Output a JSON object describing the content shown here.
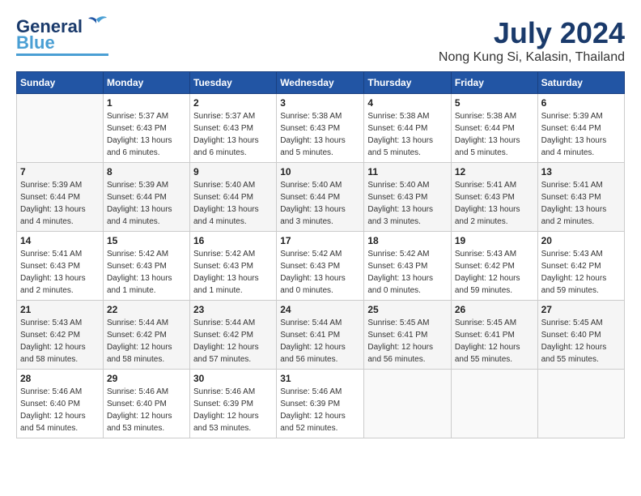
{
  "header": {
    "logo_general": "General",
    "logo_blue": "Blue",
    "month_year": "July 2024",
    "location": "Nong Kung Si, Kalasin, Thailand"
  },
  "weekdays": [
    "Sunday",
    "Monday",
    "Tuesday",
    "Wednesday",
    "Thursday",
    "Friday",
    "Saturday"
  ],
  "weeks": [
    [
      {
        "day": "",
        "info": ""
      },
      {
        "day": "1",
        "info": "Sunrise: 5:37 AM\nSunset: 6:43 PM\nDaylight: 13 hours\nand 6 minutes."
      },
      {
        "day": "2",
        "info": "Sunrise: 5:37 AM\nSunset: 6:43 PM\nDaylight: 13 hours\nand 6 minutes."
      },
      {
        "day": "3",
        "info": "Sunrise: 5:38 AM\nSunset: 6:43 PM\nDaylight: 13 hours\nand 5 minutes."
      },
      {
        "day": "4",
        "info": "Sunrise: 5:38 AM\nSunset: 6:44 PM\nDaylight: 13 hours\nand 5 minutes."
      },
      {
        "day": "5",
        "info": "Sunrise: 5:38 AM\nSunset: 6:44 PM\nDaylight: 13 hours\nand 5 minutes."
      },
      {
        "day": "6",
        "info": "Sunrise: 5:39 AM\nSunset: 6:44 PM\nDaylight: 13 hours\nand 4 minutes."
      }
    ],
    [
      {
        "day": "7",
        "info": "Sunrise: 5:39 AM\nSunset: 6:44 PM\nDaylight: 13 hours\nand 4 minutes."
      },
      {
        "day": "8",
        "info": "Sunrise: 5:39 AM\nSunset: 6:44 PM\nDaylight: 13 hours\nand 4 minutes."
      },
      {
        "day": "9",
        "info": "Sunrise: 5:40 AM\nSunset: 6:44 PM\nDaylight: 13 hours\nand 4 minutes."
      },
      {
        "day": "10",
        "info": "Sunrise: 5:40 AM\nSunset: 6:44 PM\nDaylight: 13 hours\nand 3 minutes."
      },
      {
        "day": "11",
        "info": "Sunrise: 5:40 AM\nSunset: 6:43 PM\nDaylight: 13 hours\nand 3 minutes."
      },
      {
        "day": "12",
        "info": "Sunrise: 5:41 AM\nSunset: 6:43 PM\nDaylight: 13 hours\nand 2 minutes."
      },
      {
        "day": "13",
        "info": "Sunrise: 5:41 AM\nSunset: 6:43 PM\nDaylight: 13 hours\nand 2 minutes."
      }
    ],
    [
      {
        "day": "14",
        "info": "Sunrise: 5:41 AM\nSunset: 6:43 PM\nDaylight: 13 hours\nand 2 minutes."
      },
      {
        "day": "15",
        "info": "Sunrise: 5:42 AM\nSunset: 6:43 PM\nDaylight: 13 hours\nand 1 minute."
      },
      {
        "day": "16",
        "info": "Sunrise: 5:42 AM\nSunset: 6:43 PM\nDaylight: 13 hours\nand 1 minute."
      },
      {
        "day": "17",
        "info": "Sunrise: 5:42 AM\nSunset: 6:43 PM\nDaylight: 13 hours\nand 0 minutes."
      },
      {
        "day": "18",
        "info": "Sunrise: 5:42 AM\nSunset: 6:43 PM\nDaylight: 13 hours\nand 0 minutes."
      },
      {
        "day": "19",
        "info": "Sunrise: 5:43 AM\nSunset: 6:42 PM\nDaylight: 12 hours\nand 59 minutes."
      },
      {
        "day": "20",
        "info": "Sunrise: 5:43 AM\nSunset: 6:42 PM\nDaylight: 12 hours\nand 59 minutes."
      }
    ],
    [
      {
        "day": "21",
        "info": "Sunrise: 5:43 AM\nSunset: 6:42 PM\nDaylight: 12 hours\nand 58 minutes."
      },
      {
        "day": "22",
        "info": "Sunrise: 5:44 AM\nSunset: 6:42 PM\nDaylight: 12 hours\nand 58 minutes."
      },
      {
        "day": "23",
        "info": "Sunrise: 5:44 AM\nSunset: 6:42 PM\nDaylight: 12 hours\nand 57 minutes."
      },
      {
        "day": "24",
        "info": "Sunrise: 5:44 AM\nSunset: 6:41 PM\nDaylight: 12 hours\nand 56 minutes."
      },
      {
        "day": "25",
        "info": "Sunrise: 5:45 AM\nSunset: 6:41 PM\nDaylight: 12 hours\nand 56 minutes."
      },
      {
        "day": "26",
        "info": "Sunrise: 5:45 AM\nSunset: 6:41 PM\nDaylight: 12 hours\nand 55 minutes."
      },
      {
        "day": "27",
        "info": "Sunrise: 5:45 AM\nSunset: 6:40 PM\nDaylight: 12 hours\nand 55 minutes."
      }
    ],
    [
      {
        "day": "28",
        "info": "Sunrise: 5:46 AM\nSunset: 6:40 PM\nDaylight: 12 hours\nand 54 minutes."
      },
      {
        "day": "29",
        "info": "Sunrise: 5:46 AM\nSunset: 6:40 PM\nDaylight: 12 hours\nand 53 minutes."
      },
      {
        "day": "30",
        "info": "Sunrise: 5:46 AM\nSunset: 6:39 PM\nDaylight: 12 hours\nand 53 minutes."
      },
      {
        "day": "31",
        "info": "Sunrise: 5:46 AM\nSunset: 6:39 PM\nDaylight: 12 hours\nand 52 minutes."
      },
      {
        "day": "",
        "info": ""
      },
      {
        "day": "",
        "info": ""
      },
      {
        "day": "",
        "info": ""
      }
    ]
  ]
}
